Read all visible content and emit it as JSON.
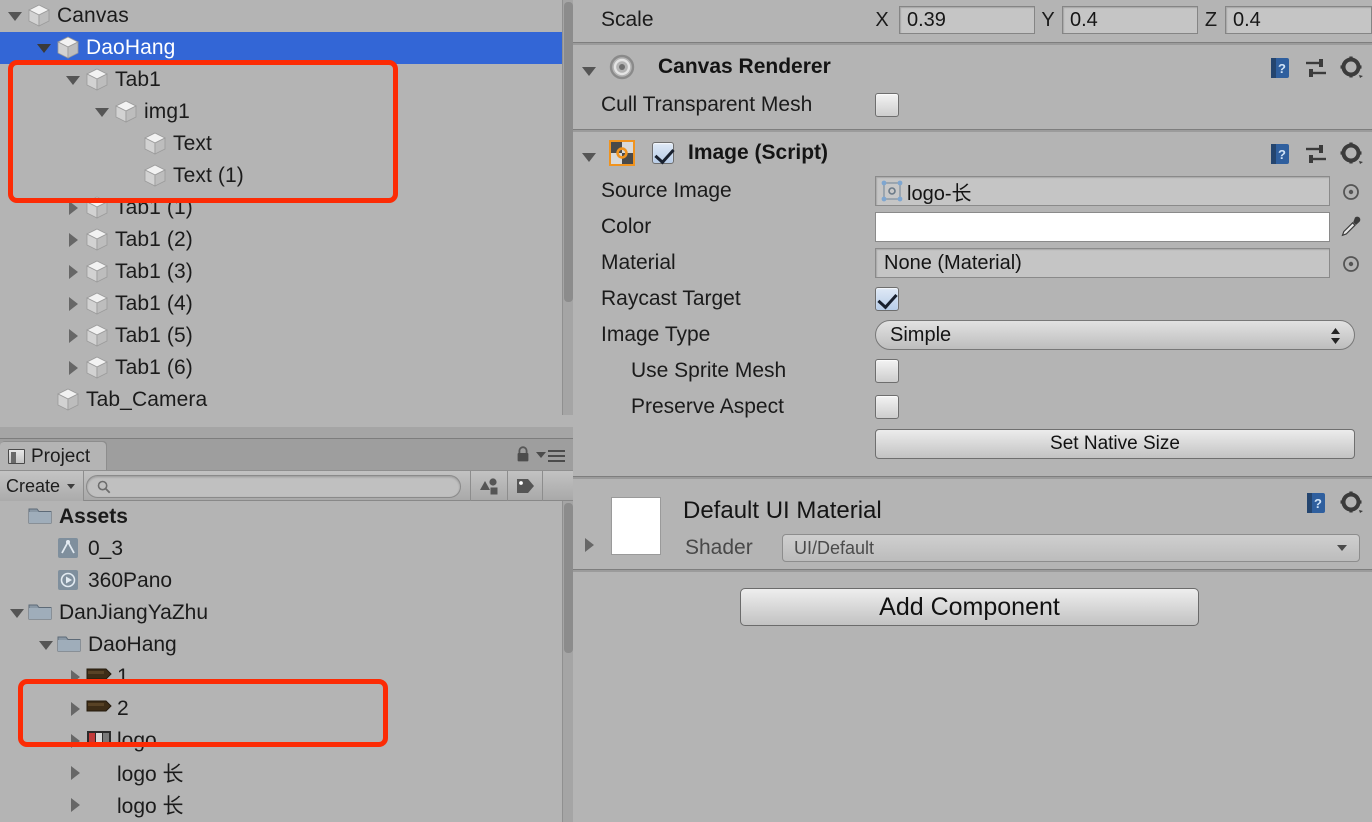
{
  "colors": {
    "panel_bg": "#b4b4b4",
    "selection_blue": "#3366d6",
    "highlight_red": "#fc2b05",
    "toolbar_gray": "#9e9e9e",
    "field_bg": "#c5c5c5"
  },
  "hierarchy": {
    "items": [
      {
        "label": "Canvas",
        "depth": 0,
        "arrow": "down",
        "selected": false
      },
      {
        "label": "DaoHang",
        "depth": 1,
        "arrow": "down",
        "selected": true
      },
      {
        "label": "Tab1",
        "depth": 2,
        "arrow": "down",
        "selected": false
      },
      {
        "label": "img1",
        "depth": 3,
        "arrow": "down",
        "selected": false
      },
      {
        "label": "Text",
        "depth": 4,
        "arrow": "none",
        "selected": false
      },
      {
        "label": "Text (1)",
        "depth": 4,
        "arrow": "none",
        "selected": false
      },
      {
        "label": "Tab1 (1)",
        "depth": 2,
        "arrow": "right",
        "selected": false
      },
      {
        "label": "Tab1 (2)",
        "depth": 2,
        "arrow": "right",
        "selected": false
      },
      {
        "label": "Tab1 (3)",
        "depth": 2,
        "arrow": "right",
        "selected": false
      },
      {
        "label": "Tab1 (4)",
        "depth": 2,
        "arrow": "right",
        "selected": false
      },
      {
        "label": "Tab1 (5)",
        "depth": 2,
        "arrow": "right",
        "selected": false
      },
      {
        "label": "Tab1 (6)",
        "depth": 2,
        "arrow": "right",
        "selected": false
      },
      {
        "label": "Tab_Camera",
        "depth": 1,
        "arrow": "none",
        "selected": false
      }
    ]
  },
  "project": {
    "tab_label": "Project",
    "lock_icon": "lock-icon",
    "menu_icon": "hamburger-menu-icon",
    "create_label": "Create",
    "search_placeholder": "",
    "search_value": "",
    "search_icon": "search-icon",
    "filter_type_icon": "filter-by-type-icon",
    "filter_label_icon": "filter-by-label-icon",
    "items": [
      {
        "label": "Assets",
        "depth": 0,
        "arrow": "none",
        "icon": "folder-icon",
        "bold": true
      },
      {
        "label": "0_3",
        "depth": 1,
        "arrow": "none",
        "icon": "scene-icon",
        "bold": false
      },
      {
        "label": "360Pano",
        "depth": 1,
        "arrow": "none",
        "icon": "video-icon",
        "bold": false
      },
      {
        "label": "DanJiangYaZhu",
        "depth": 0,
        "arrow": "down",
        "icon": "folder-icon",
        "bold": false
      },
      {
        "label": "DaoHang",
        "depth": 1,
        "arrow": "down",
        "icon": "folder-icon",
        "bold": false
      },
      {
        "label": "1",
        "depth": 2,
        "arrow": "right",
        "icon": "texture-icon",
        "bold": false
      },
      {
        "label": "2",
        "depth": 2,
        "arrow": "right",
        "icon": "texture-icon",
        "bold": false
      },
      {
        "label": "logo",
        "depth": 2,
        "arrow": "right",
        "icon": "texture-icon",
        "bold": false
      },
      {
        "label": "logo 长",
        "depth": 2,
        "arrow": "right",
        "icon": "none",
        "bold": false
      },
      {
        "label": "logo 长",
        "depth": 2,
        "arrow": "right",
        "icon": "none",
        "bold": false
      }
    ]
  },
  "inspector": {
    "transform": {
      "scale_label": "Scale",
      "x_axis": "X",
      "x_value": "0.39",
      "y_axis": "Y",
      "y_value": "0.4",
      "z_axis": "Z",
      "z_value": "0.4"
    },
    "canvas_renderer": {
      "title": "Canvas Renderer",
      "icon": "canvas-renderer-icon",
      "help_icon": "help-icon",
      "preset_icon": "preset-icon",
      "settings_icon": "gear-icon",
      "cull_label": "Cull Transparent Mesh",
      "cull_checked": false
    },
    "image_script": {
      "title": "Image (Script)",
      "icon": "sprite-icon",
      "enabled": true,
      "help_icon": "help-icon",
      "preset_icon": "preset-icon",
      "settings_icon": "gear-icon",
      "source_image_label": "Source Image",
      "source_image_value": "logo-长",
      "source_image_icon": "sprite-thumbnail-icon",
      "color_label": "Color",
      "color_value": "#ffffff",
      "eyedropper_icon": "eyedropper-icon",
      "material_label": "Material",
      "material_value": "None (Material)",
      "raycast_label": "Raycast Target",
      "raycast_checked": true,
      "image_type_label": "Image Type",
      "image_type_value": "Simple",
      "use_sprite_mesh_label": "Use Sprite Mesh",
      "use_sprite_mesh_checked": false,
      "preserve_aspect_label": "Preserve Aspect",
      "preserve_aspect_checked": false,
      "set_native_size_label": "Set Native Size",
      "picker_icon": "object-picker-icon"
    },
    "material": {
      "title": "Default UI Material",
      "shader_label": "Shader",
      "shader_value": "UI/Default",
      "help_icon": "help-icon",
      "settings_icon": "gear-icon",
      "expand_icon": "chevron-right-icon"
    },
    "add_component_label": "Add Component"
  }
}
